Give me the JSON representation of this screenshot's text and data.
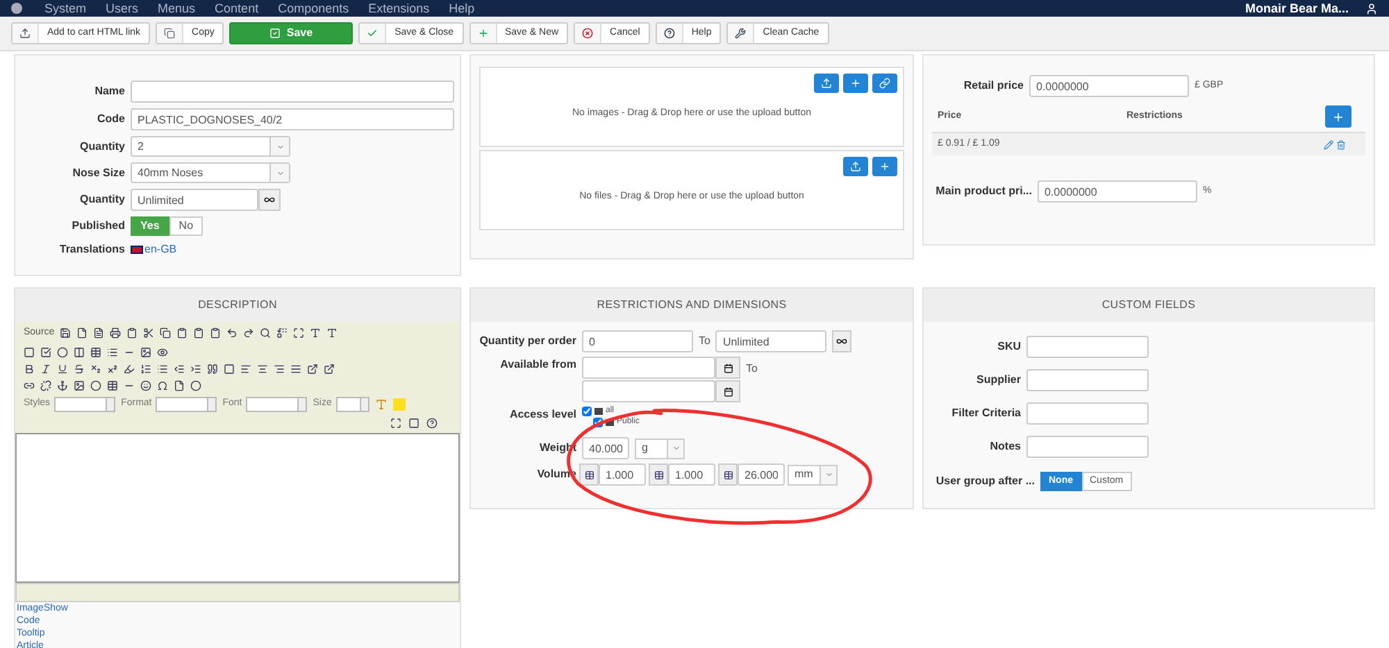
{
  "navbar": {
    "menu": [
      "System",
      "Users",
      "Menus",
      "Content",
      "Components",
      "Extensions",
      "Help"
    ],
    "site": "Monair Bear Ma..."
  },
  "toolbar": [
    {
      "label": "Add to cart HTML link",
      "kind": "upload",
      "primary": false
    },
    {
      "label": "Copy",
      "kind": "copy",
      "primary": false
    },
    {
      "label": "Save",
      "kind": "save",
      "primary": true
    },
    {
      "label": "Save & Close",
      "kind": "check",
      "primary": false
    },
    {
      "label": "Save & New",
      "kind": "plus",
      "primary": false
    },
    {
      "label": "Cancel",
      "kind": "cancel",
      "primary": false
    },
    {
      "label": "Help",
      "kind": "help",
      "primary": false
    },
    {
      "label": "Clean Cache",
      "kind": "tools",
      "primary": false
    }
  ],
  "main_options": {
    "fields": [
      {
        "label": "Name",
        "kind": "text"
      },
      {
        "label": "Code",
        "kind": "text",
        "value": "PLASTIC_DOGNOSES_40/2"
      },
      {
        "label": "Quantity",
        "kind": "select",
        "value": "2"
      },
      {
        "label": "Nose Size",
        "kind": "select",
        "value": "40mm Noses"
      },
      {
        "label": "Quantity",
        "kind": "infinity",
        "value": "Unlimited"
      },
      {
        "label": "Published",
        "kind": "toggle",
        "options": [
          {
            "label": "Yes",
            "selected": true
          },
          {
            "label": "No",
            "selected": false
          }
        ]
      },
      {
        "label": "Translations",
        "kind": "link",
        "value": "en-GB"
      }
    ]
  },
  "images_files": {
    "sections": [
      {
        "message": "No images - Drag & Drop here or use the upload button",
        "link_button": true
      },
      {
        "message": "No files - Drag & Drop here or use the upload button",
        "link_button": false
      }
    ]
  },
  "prices": {
    "retail": {
      "label": "Retail price",
      "value": "0.0000000",
      "unit": "£ GBP"
    },
    "table": {
      "columns": [
        "Price",
        "Restrictions"
      ],
      "rows": [
        {
          "price": "£ 0.91 / £ 1.09"
        }
      ]
    },
    "main_product": {
      "label": "Main product pri...",
      "value": "0.0000000",
      "unit": "%"
    }
  },
  "description": {
    "title": "DESCRIPTION",
    "source": "Source",
    "selects": [
      "Styles",
      "Format",
      "Font",
      "Size"
    ],
    "links": [
      "ImageShow",
      "Code",
      "Tooltip",
      "Article"
    ]
  },
  "restrictions": {
    "title": "RESTRICTIONS AND DIMENSIONS",
    "quantity_per_order": {
      "label": "Quantity per order",
      "value": "0",
      "to_label": "To",
      "to_value": "Unlimited"
    },
    "available_from": {
      "label": "Available from",
      "to_label": "To"
    },
    "access_level": {
      "label": "Access level",
      "items": [
        {
          "label": "all",
          "checked": true
        },
        {
          "label": "Public",
          "checked": true
        }
      ]
    },
    "weight": {
      "label": "Weight",
      "value": "40.000",
      "unit": "g"
    },
    "volume": {
      "label": "Volume",
      "values": [
        "1.000",
        "1.000",
        "26.000"
      ],
      "unit": "mm"
    }
  },
  "custom_fields": {
    "title": "CUSTOM FIELDS",
    "fields": [
      {
        "label": "SKU"
      },
      {
        "label": "Supplier"
      },
      {
        "label": "Filter Criteria"
      },
      {
        "label": "Notes"
      }
    ],
    "user_group": {
      "label": "User group after ...",
      "options": [
        {
          "label": "None",
          "selected": true
        },
        {
          "label": "Custom",
          "selected": false
        }
      ]
    }
  }
}
